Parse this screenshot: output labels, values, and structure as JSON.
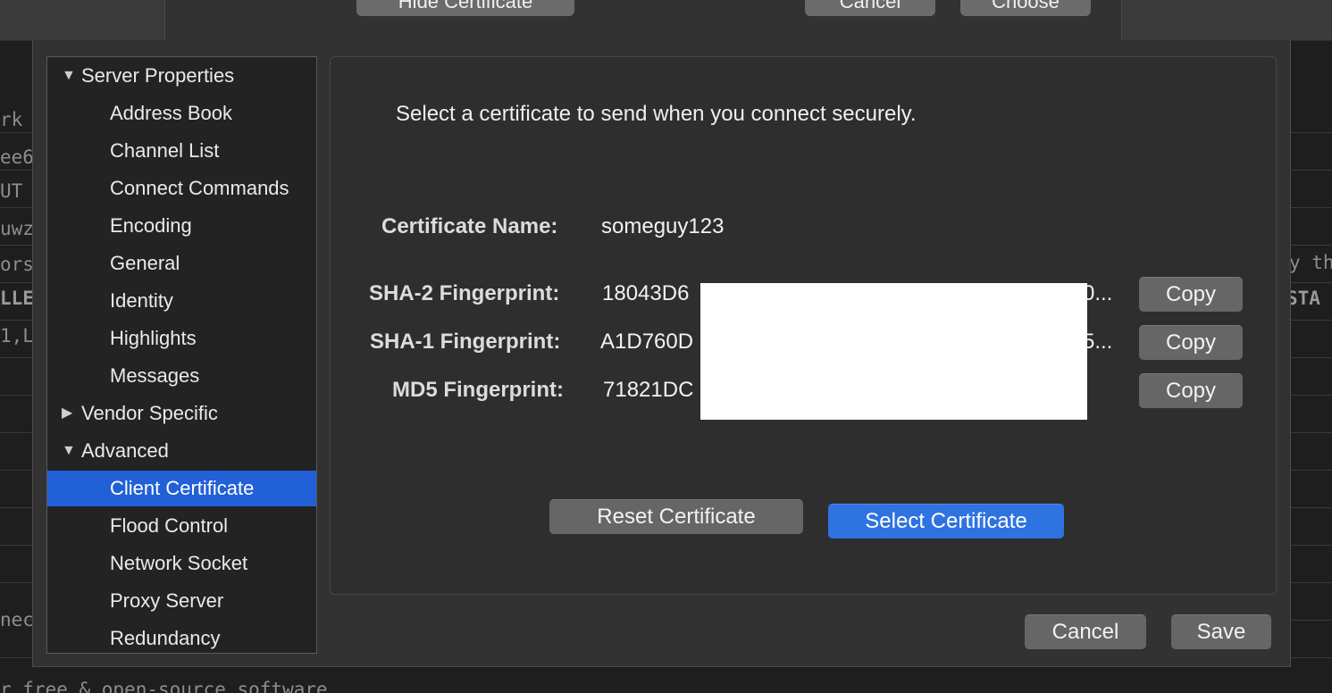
{
  "background": {
    "fragments_left": [
      "rk s",
      "ee6",
      " UT",
      "uwz",
      "orst",
      "LLE",
      "1,L",
      "nec"
    ],
    "fragments_right": [
      "y th",
      " STA"
    ],
    "footer_text": "r free & open-source software"
  },
  "parent_sheet": {
    "hide_certificate_label": "Hide Certificate",
    "cancel_label": "Cancel",
    "choose_label": "Choose"
  },
  "sidebar": {
    "items": [
      {
        "label": "Server Properties",
        "type": "group",
        "expanded": true
      },
      {
        "label": "Address Book",
        "type": "child"
      },
      {
        "label": "Channel List",
        "type": "child"
      },
      {
        "label": "Connect Commands",
        "type": "child"
      },
      {
        "label": "Encoding",
        "type": "child"
      },
      {
        "label": "General",
        "type": "child"
      },
      {
        "label": "Identity",
        "type": "child"
      },
      {
        "label": "Highlights",
        "type": "child"
      },
      {
        "label": "Messages",
        "type": "child"
      },
      {
        "label": "Vendor Specific",
        "type": "group",
        "expanded": false
      },
      {
        "label": "Advanced",
        "type": "group",
        "expanded": true
      },
      {
        "label": "Client Certificate",
        "type": "child",
        "selected": true
      },
      {
        "label": "Flood Control",
        "type": "child"
      },
      {
        "label": "Network Socket",
        "type": "child"
      },
      {
        "label": "Proxy Server",
        "type": "child"
      },
      {
        "label": "Redundancy",
        "type": "child"
      }
    ],
    "triangle_expanded": "▼",
    "triangle_collapsed": "▶"
  },
  "main": {
    "instruction": "Select a certificate to send when you connect securely.",
    "certificate_name_label": "Certificate Name:",
    "certificate_name_value": "someguy123",
    "sha2_label": "SHA-2 Fingerprint:",
    "sha2_value_start": "18043D6",
    "sha2_value_end": "0...",
    "sha1_label": "SHA-1 Fingerprint:",
    "sha1_value_start": "A1D760D",
    "sha1_value_end": "5...",
    "md5_label": "MD5 Fingerprint:",
    "md5_value_start": "71821DC",
    "copy_label": "Copy",
    "reset_certificate_label": "Reset Certificate",
    "select_certificate_label": "Select Certificate"
  },
  "footer": {
    "cancel_label": "Cancel",
    "save_label": "Save"
  },
  "colors": {
    "selection_blue": "#2160d6",
    "primary_button_blue": "#2e73e0"
  }
}
